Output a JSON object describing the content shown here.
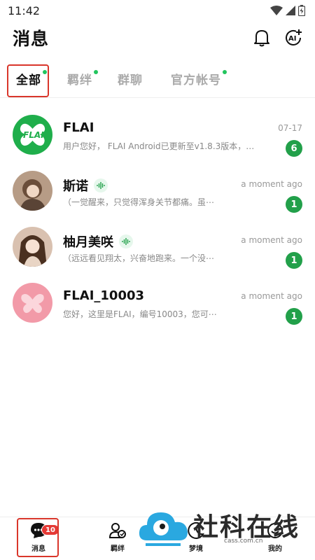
{
  "status": {
    "time": "11:42"
  },
  "header": {
    "title": "消息",
    "bell_icon": "bell-icon",
    "ai_icon": "ai-add-icon",
    "ai_text": "AI"
  },
  "tabs": [
    {
      "label": "全部",
      "dot": true,
      "active": true
    },
    {
      "label": "羁绊",
      "dot": true,
      "active": false
    },
    {
      "label": "群聊",
      "dot": false,
      "active": false
    },
    {
      "label": "官方帐号",
      "dot": true,
      "active": false
    }
  ],
  "conversations": [
    {
      "name": "FLAI",
      "preview": "用户您好，  FLAI Android已更新至v1.8.3版本，…",
      "time": "07-17",
      "unread": "6",
      "voice": false,
      "avatar_text": "FLAI"
    },
    {
      "name": "斯诺",
      "preview": "（一觉醒来，只觉得浑身关节都痛。虽⋯",
      "time": "a moment ago",
      "unread": "1",
      "voice": true
    },
    {
      "name": "柚月美咲",
      "preview": "（远远看见翔太，兴奋地跑来。一个没⋯",
      "time": "a moment ago",
      "unread": "1",
      "voice": true
    },
    {
      "name": "FLAI_10003",
      "preview": "您好，这里是FLAI，编号10003，您可⋯",
      "time": "a moment ago",
      "unread": "1",
      "voice": false
    }
  ],
  "bottom_nav": [
    {
      "label": "消息",
      "icon": "chat-bubble-icon",
      "badge": "10"
    },
    {
      "label": "羁绊",
      "icon": "users-icon"
    },
    {
      "label": "梦境",
      "icon": "moon-icon"
    },
    {
      "label": "我的",
      "icon": "profile-icon"
    }
  ],
  "watermark": {
    "text": "社科在线",
    "url": "cass.com.cn"
  },
  "colors": {
    "accent_green": "#22a04a",
    "highlight_red": "#d9362b",
    "badge_red": "#e53935"
  }
}
